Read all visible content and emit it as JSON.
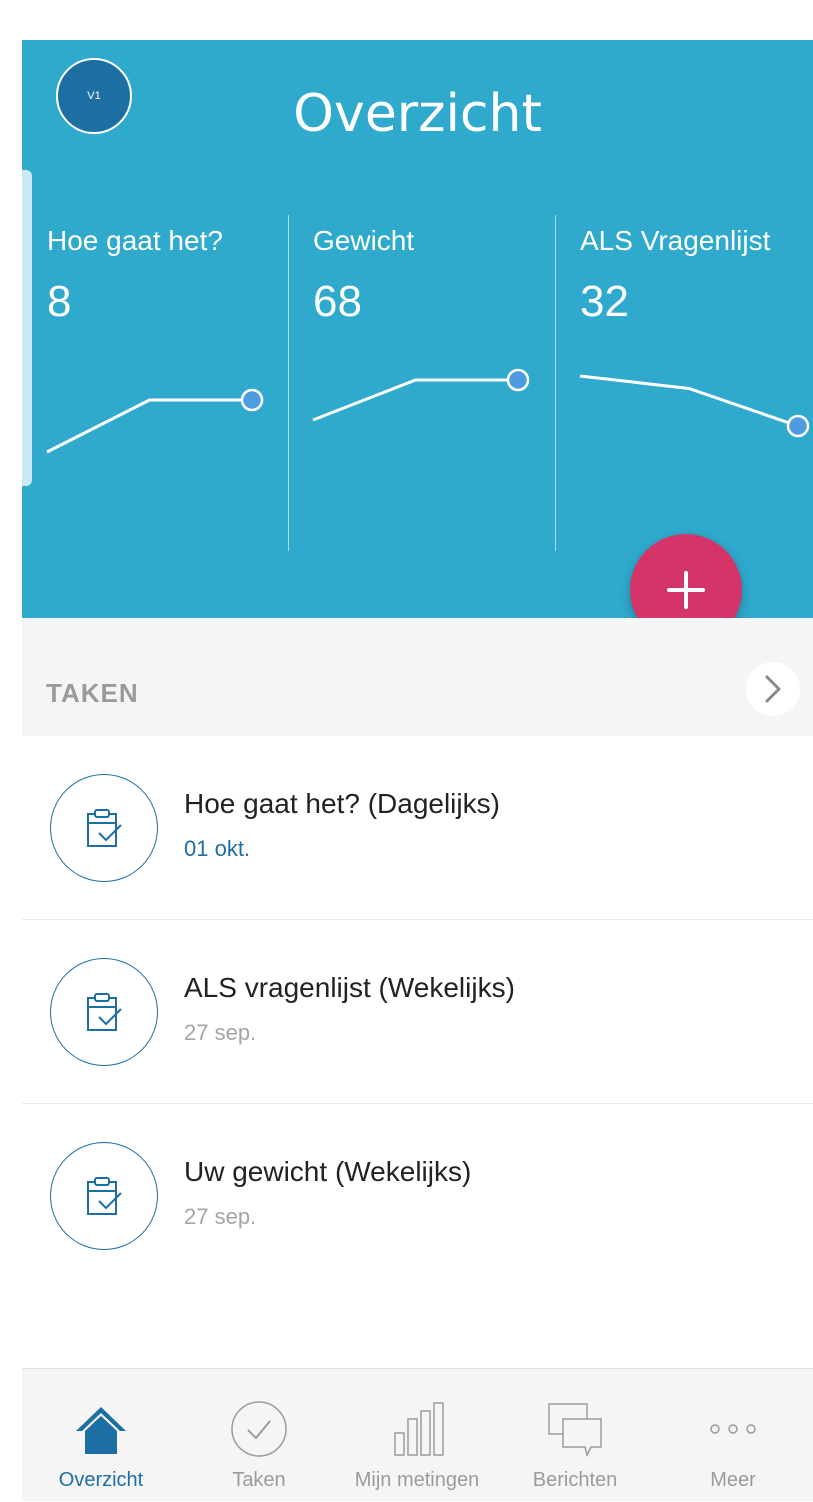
{
  "header": {
    "avatar_initials": "V1",
    "title": "Overzicht"
  },
  "metrics": [
    {
      "label": "Hoe gaat het?",
      "value": "8",
      "trend": [
        6,
        8,
        8
      ]
    },
    {
      "label": "Gewicht",
      "value": "68",
      "trend": [
        67.5,
        68,
        68
      ]
    },
    {
      "label": "ALS Vragenlijst",
      "value": "32",
      "trend": [
        36,
        35,
        32
      ]
    }
  ],
  "fab": {
    "icon": "plus-icon"
  },
  "tasks_section": {
    "title": "TAKEN",
    "arrow_icon": "chevron-right-icon",
    "items": [
      {
        "title": "Hoe gaat het? (Dagelijks)",
        "date": "01 okt.",
        "icon": "clipboard-check-icon"
      },
      {
        "title": "ALS vragenlijst (Wekelijks)",
        "date": "27 sep.",
        "icon": "clipboard-check-icon"
      },
      {
        "title": "Uw gewicht (Wekelijks)",
        "date": "27 sep.",
        "icon": "clipboard-check-icon"
      }
    ]
  },
  "bottom_nav": {
    "items": [
      {
        "label": "Overzicht",
        "icon": "home-icon",
        "active": true
      },
      {
        "label": "Taken",
        "icon": "check-circle-icon",
        "active": false
      },
      {
        "label": "Mijn metingen",
        "icon": "bar-chart-icon",
        "active": false
      },
      {
        "label": "Berichten",
        "icon": "chat-bubbles-icon",
        "active": false
      },
      {
        "label": "Meer",
        "icon": "more-dots-icon",
        "active": false
      }
    ]
  },
  "colors": {
    "header_bg": "#2fa9cc",
    "accent": "#1d6fa3",
    "fab": "#d53469",
    "muted_text": "#a5a5a5"
  }
}
